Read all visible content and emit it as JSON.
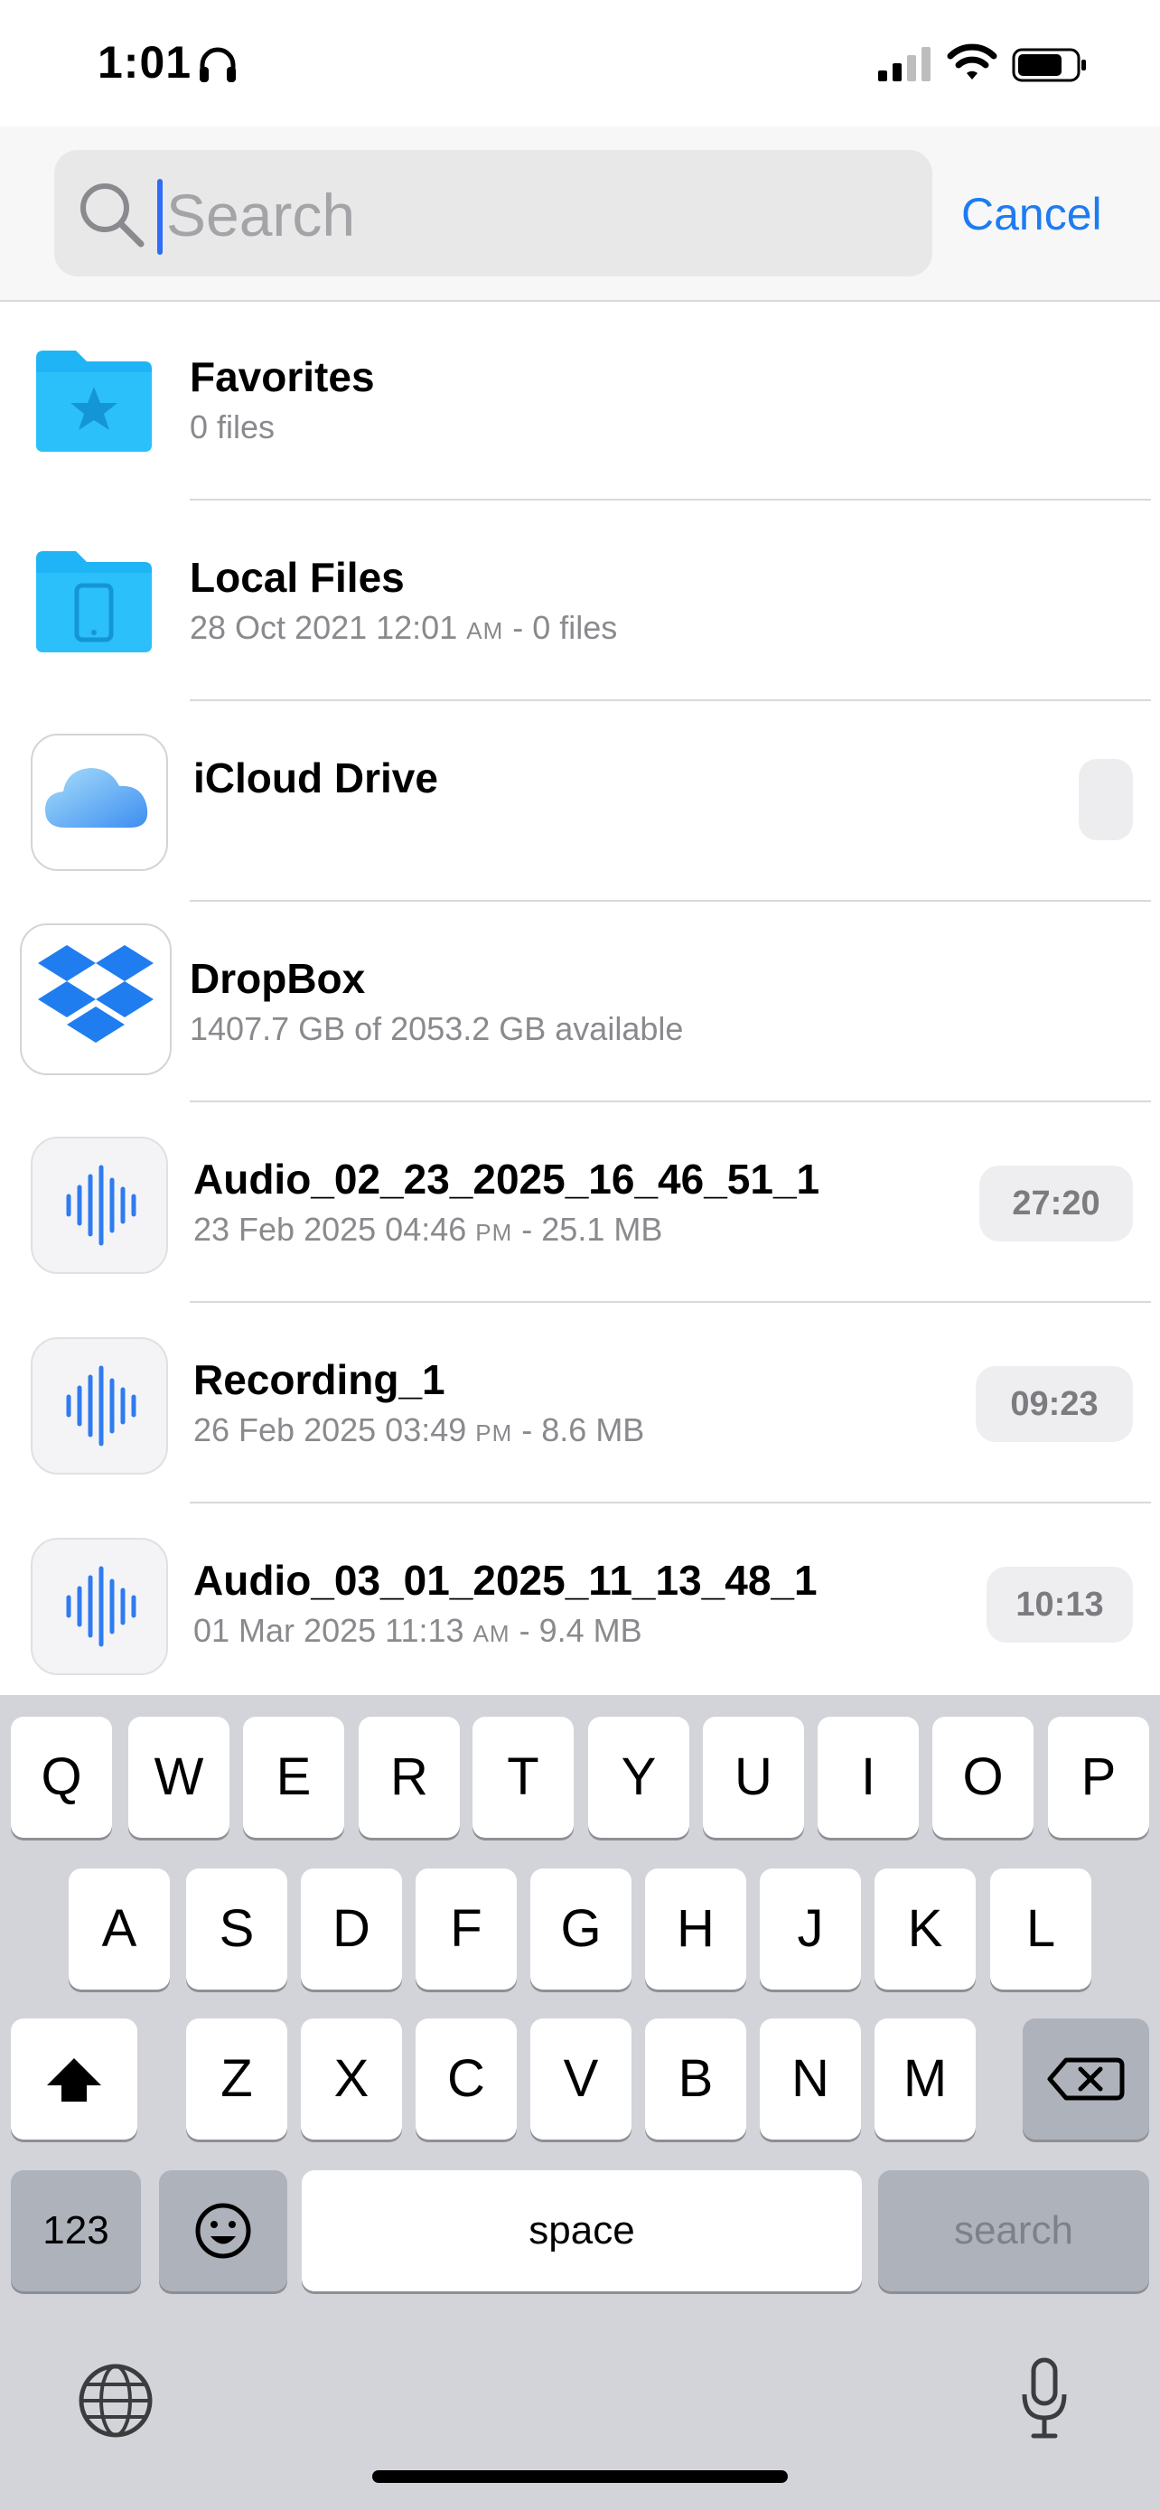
{
  "status_bar": {
    "time": "1:01"
  },
  "search": {
    "placeholder": "Search",
    "cancel_label": "Cancel"
  },
  "items": [
    {
      "title": "Favorites",
      "subtitle": "0 files"
    },
    {
      "title": "Local Files",
      "subtitle_date": "28 Oct 2021 12:01",
      "subtitle_ampm": "AM",
      "subtitle_rest": " - 0 files"
    },
    {
      "title": "iCloud Drive"
    },
    {
      "title": "DropBox",
      "subtitle": "1407.7 GB of 2053.2 GB available"
    },
    {
      "title": "Audio_02_23_2025_16_46_51_1",
      "subtitle_date": "23 Feb 2025 04:46",
      "subtitle_ampm": "PM",
      "subtitle_rest": " - 25.1 MB",
      "duration": "27:20"
    },
    {
      "title": "Recording_1",
      "subtitle_date": "26 Feb 2025 03:49",
      "subtitle_ampm": "PM",
      "subtitle_rest": " - 8.6 MB",
      "duration": "09:23"
    },
    {
      "title": "Audio_03_01_2025_11_13_48_1",
      "subtitle_date": "01 Mar 2025 11:13",
      "subtitle_ampm": "AM",
      "subtitle_rest": " - 9.4 MB",
      "duration": "10:13"
    }
  ],
  "keyboard": {
    "row1": [
      "Q",
      "W",
      "E",
      "R",
      "T",
      "Y",
      "U",
      "I",
      "O",
      "P"
    ],
    "row2": [
      "A",
      "S",
      "D",
      "F",
      "G",
      "H",
      "J",
      "K",
      "L"
    ],
    "row3": [
      "Z",
      "X",
      "C",
      "V",
      "B",
      "N",
      "M"
    ],
    "numbers_label": "123",
    "space_label": "space",
    "search_label": "search"
  },
  "colors": {
    "accent": "#1d7cf2",
    "folder": "#1fb4f5",
    "audio_wave": "#2f7bf0"
  }
}
